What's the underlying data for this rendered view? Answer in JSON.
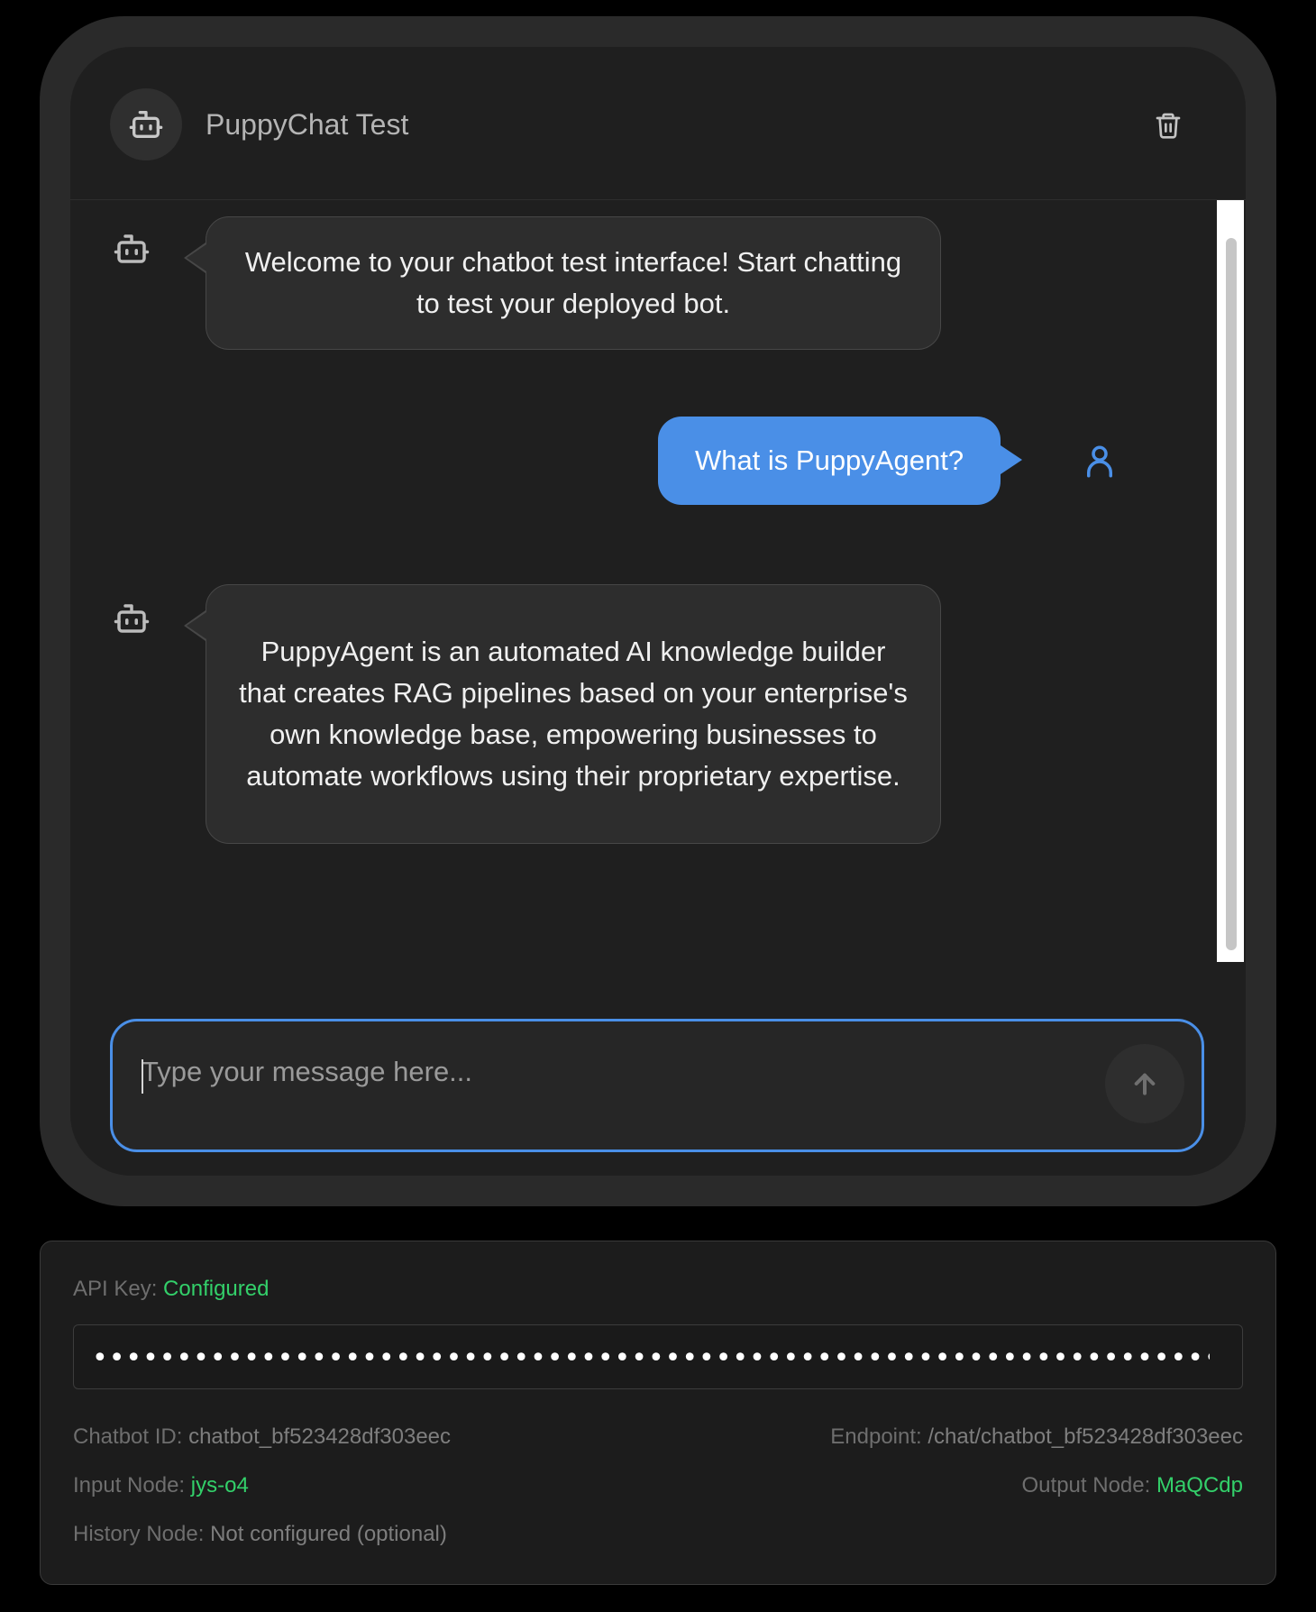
{
  "header": {
    "title": "PuppyChat Test",
    "avatar_icon": "bot-icon",
    "delete_icon": "trash-icon"
  },
  "messages": [
    {
      "role": "bot",
      "icon": "bot-icon",
      "text": "Welcome to your chatbot test interface! Start chatting to test your deployed bot."
    },
    {
      "role": "user",
      "icon": "user-icon",
      "text": "What is PuppyAgent?"
    },
    {
      "role": "bot",
      "icon": "bot-icon",
      "text": "PuppyAgent is an automated AI knowledge builder that creates RAG pipelines based on your enterprise's own knowledge base, empowering businesses to automate workflows using their proprietary expertise."
    }
  ],
  "input": {
    "placeholder": "Type your message here...",
    "value": "",
    "send_icon": "arrow-up-icon"
  },
  "config": {
    "api_key_label": "API Key:",
    "api_key_status": "Configured",
    "api_key_masked": "••••••••••••••••••••••••••••••••••••••••••••••••••••••••••••••••••••",
    "chatbot_id_label": "Chatbot ID:",
    "chatbot_id_value": "chatbot_bf523428df303eec",
    "endpoint_label": "Endpoint:",
    "endpoint_value": "/chat/chatbot_bf523428df303eec",
    "input_node_label": "Input Node:",
    "input_node_value": "jys-o4",
    "output_node_label": "Output Node:",
    "output_node_value": "MaQCdp",
    "history_node_label": "History Node:",
    "history_node_value": "Not configured (optional)"
  },
  "colors": {
    "accent": "#4a8fe7",
    "success": "#33d06a",
    "panel": "#1f1f1f",
    "frame": "#2a2a2a"
  }
}
